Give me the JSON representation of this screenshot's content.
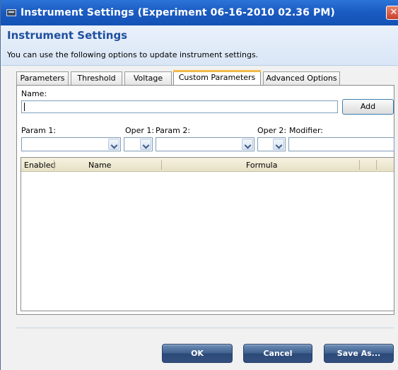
{
  "window": {
    "title": "Instrument Settings (Experiment 06-16-2010 02.36 PM)",
    "close_glyph": "✕"
  },
  "header": {
    "heading": "Instrument Settings",
    "subtitle": "You can use the following options to update instrument settings."
  },
  "tabs": [
    {
      "label": "Parameters",
      "active": false
    },
    {
      "label": "Threshold",
      "active": false
    },
    {
      "label": "Voltage",
      "active": false
    },
    {
      "label": "Custom Parameters",
      "active": true
    },
    {
      "label": "Advanced Options",
      "active": false
    }
  ],
  "custom_parameters": {
    "name_label": "Name:",
    "name_value": "",
    "add_button": "Add",
    "param1_label": "Param 1:",
    "oper1_label": "Oper 1:",
    "param2_label": "Param 2:",
    "oper2_label": "Oper 2:",
    "modifier_label": "Modifier:",
    "param1_value": "",
    "oper1_value": "",
    "param2_value": "",
    "oper2_value": "",
    "modifier_value": ""
  },
  "grid": {
    "columns": [
      "Enabled",
      "Name",
      "Formula"
    ],
    "rows": []
  },
  "footer": {
    "ok": "OK",
    "cancel": "Cancel",
    "save_as": "Save As..."
  },
  "colors": {
    "titlebar": "#1b5cc2",
    "heading": "#1f4f9e",
    "active_tab_accent": "#f0b94b",
    "footer_button": "#3f5f8e"
  }
}
